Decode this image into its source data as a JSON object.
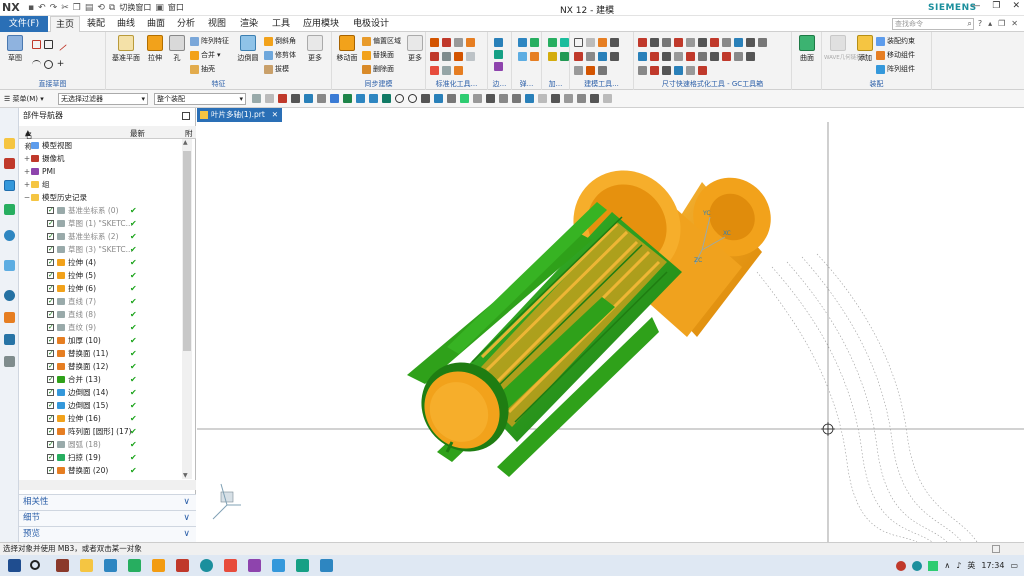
{
  "app": {
    "logo": "NX",
    "window_title": "NX 12 - 建模",
    "brand": "SIEMENS",
    "qat_switch_window": "切换窗口",
    "qat_window": "窗口"
  },
  "tabs": {
    "file": "文件(F)",
    "items": [
      "主页",
      "装配",
      "曲线",
      "曲面",
      "分析",
      "视图",
      "渲染",
      "工具",
      "应用模块",
      "电极设计"
    ],
    "active": "主页",
    "search_placeholder": "查找命令"
  },
  "ribbon": {
    "sketch": "草图",
    "direct_sketch_group": "直接草图",
    "datum_plane": "基准平面",
    "extrude": "拉伸",
    "hole": "孔",
    "pattern_feature": "阵列特征",
    "unite": "合并",
    "shell": "抽壳",
    "edge_blend": "边倒圆",
    "chamfer": "倒斜角",
    "trim_body": "修剪体",
    "draft": "拔模",
    "more": "更多",
    "feature_group": "特征",
    "move_face": "移动面",
    "offset_region": "偏置区域",
    "replace_face": "替换面",
    "delete_face": "删除面",
    "sync_group": "同步建模",
    "standard_tools": "标准化工具...",
    "edge": "边...",
    "spring": "弹...",
    "add": "加...",
    "build_tools": "建模工具...",
    "gc_toolbox": "尺寸快速格式化工具 - GC工具箱",
    "surface": "曲面",
    "assembly_constraint": "装配约束",
    "add_component": "添加",
    "move_component": "移动组件",
    "pattern_component": "阵列组件",
    "assembly_group": "装配",
    "wave_link": "WAVE几何链接器"
  },
  "selbar": {
    "menu": "菜单(M)",
    "filter": "无选择过滤器",
    "scope": "整个装配"
  },
  "navigator": {
    "title": "部件导航器",
    "col_name": "名称",
    "col_latest": "最新",
    "col_extra": "附",
    "rows": [
      {
        "name": "模型视图",
        "level": 0,
        "exp": "+",
        "grey": false,
        "check": false,
        "ok": false
      },
      {
        "name": "摄像机",
        "level": 0,
        "exp": "+",
        "grey": false,
        "check": false,
        "ok": false
      },
      {
        "name": "PMI",
        "level": 0,
        "exp": "+",
        "grey": false,
        "check": false,
        "ok": false
      },
      {
        "name": "组",
        "level": 0,
        "exp": "+",
        "grey": false,
        "check": false,
        "ok": false
      },
      {
        "name": "模型历史记录",
        "level": 0,
        "exp": "−",
        "grey": false,
        "check": false,
        "ok": false
      },
      {
        "name": "基准坐标系 (0)",
        "level": 1,
        "exp": "",
        "grey": true,
        "check": true,
        "ok": true
      },
      {
        "name": "草图 (1) \"SKETC...",
        "level": 1,
        "exp": "",
        "grey": true,
        "check": true,
        "ok": true
      },
      {
        "name": "基准坐标系 (2)",
        "level": 1,
        "exp": "",
        "grey": true,
        "check": true,
        "ok": true
      },
      {
        "name": "草图 (3) \"SKETC...",
        "level": 1,
        "exp": "",
        "grey": true,
        "check": true,
        "ok": true
      },
      {
        "name": "拉伸 (4)",
        "level": 1,
        "exp": "",
        "grey": false,
        "check": true,
        "ok": true
      },
      {
        "name": "拉伸 (5)",
        "level": 1,
        "exp": "",
        "grey": false,
        "check": true,
        "ok": true
      },
      {
        "name": "拉伸 (6)",
        "level": 1,
        "exp": "",
        "grey": false,
        "check": true,
        "ok": true
      },
      {
        "name": "直线 (7)",
        "level": 1,
        "exp": "",
        "grey": true,
        "check": true,
        "ok": true
      },
      {
        "name": "直线 (8)",
        "level": 1,
        "exp": "",
        "grey": true,
        "check": true,
        "ok": true
      },
      {
        "name": "直纹 (9)",
        "level": 1,
        "exp": "",
        "grey": true,
        "check": true,
        "ok": true
      },
      {
        "name": "加厚 (10)",
        "level": 1,
        "exp": "",
        "grey": false,
        "check": true,
        "ok": true
      },
      {
        "name": "替换面 (11)",
        "level": 1,
        "exp": "",
        "grey": false,
        "check": true,
        "ok": true
      },
      {
        "name": "替换面 (12)",
        "level": 1,
        "exp": "",
        "grey": false,
        "check": true,
        "ok": true
      },
      {
        "name": "合并 (13)",
        "level": 1,
        "exp": "",
        "grey": false,
        "check": true,
        "ok": true
      },
      {
        "name": "边倒圆 (14)",
        "level": 1,
        "exp": "",
        "grey": false,
        "check": true,
        "ok": true
      },
      {
        "name": "边倒圆 (15)",
        "level": 1,
        "exp": "",
        "grey": false,
        "check": true,
        "ok": true
      },
      {
        "name": "拉伸 (16)",
        "level": 1,
        "exp": "",
        "grey": false,
        "check": true,
        "ok": true
      },
      {
        "name": "阵列面 [圆形] (17)",
        "level": 1,
        "exp": "",
        "grey": false,
        "check": true,
        "ok": true
      },
      {
        "name": "圆弧 (18)",
        "level": 1,
        "exp": "",
        "grey": true,
        "check": true,
        "ok": true
      },
      {
        "name": "扫掠 (19)",
        "level": 1,
        "exp": "",
        "grey": false,
        "check": true,
        "ok": true
      },
      {
        "name": "替换面 (20)",
        "level": 1,
        "exp": "",
        "grey": false,
        "check": true,
        "ok": true
      },
      {
        "name": "基准坐标系 (21)",
        "level": 1,
        "exp": "",
        "grey": true,
        "check": true,
        "ok": true
      }
    ],
    "panels": [
      "相关性",
      "细节",
      "预览"
    ]
  },
  "graphics": {
    "tab_label": "叶片多轴(1).prt",
    "axis_yc": "YC",
    "axis_xc": "XC",
    "axis_zc": "ZC"
  },
  "status": {
    "message": "选择对象并使用 MB3，或者双击某一对象"
  },
  "taskbar": {
    "ime": "英",
    "time": "17:34"
  },
  "colors": {
    "accent": "#2a6fb6",
    "body_orange": "#f2a21b",
    "body_green": "#2fa11a",
    "check_green": "#1aa31a"
  }
}
